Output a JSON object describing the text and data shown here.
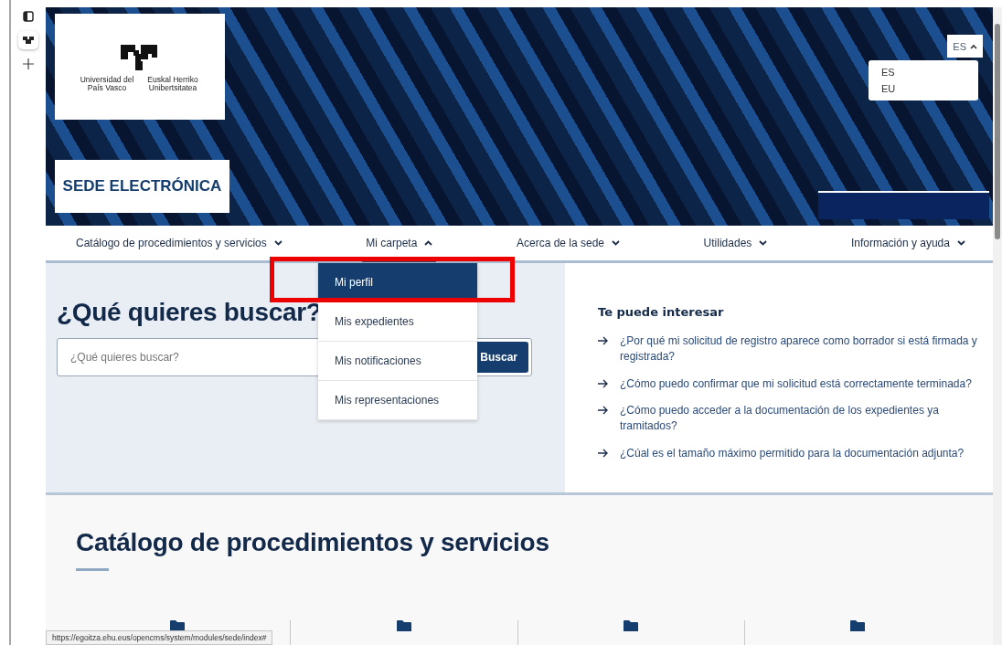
{
  "logo": {
    "name_es": "Universidad del País Vasco",
    "name_eu": "Euskal Herriko Unibertsitatea"
  },
  "site_title": "SEDE ELECTRÓNICA",
  "language": {
    "current": "ES",
    "expanded": true,
    "options": [
      "ES",
      "EU"
    ]
  },
  "nav": [
    {
      "label": "Catálogo de procedimientos y servicios",
      "selected": false,
      "expanded": false
    },
    {
      "label": "Mi carpeta",
      "selected": true,
      "expanded": true
    },
    {
      "label": "Acerca de la sede",
      "selected": false,
      "expanded": false
    },
    {
      "label": "Utilidades",
      "selected": false,
      "expanded": false
    },
    {
      "label": "Información y ayuda",
      "selected": false,
      "expanded": false
    }
  ],
  "submenu": [
    {
      "label": "Mi perfil",
      "selected": true
    },
    {
      "label": "Mis expedientes",
      "selected": false
    },
    {
      "label": "Mis notificaciones",
      "selected": false
    },
    {
      "label": "Mis representaciones",
      "selected": false
    }
  ],
  "search": {
    "heading": "¿Qué quieres buscar?",
    "placeholder": "¿Qué quieres buscar?",
    "button": "Buscar"
  },
  "suggestions": {
    "heading": "Te puede interesar",
    "items": [
      "¿Por qué mi solicitud de registro aparece como borrador si está firmada y registrada?",
      "¿Cómo puedo confirmar que mi solicitud está correctamente terminada?",
      "¿Cómo puedo acceder a la documentación de los expedientes ya tramitados?",
      "¿Cúal es el tamaño máximo permitido para la documentación adjunta?"
    ]
  },
  "catalog": {
    "heading": "Catálogo de procedimientos y servicios"
  },
  "status_url": "https://egoitza.ehu.eus/opencms/system/modules/sede/index#"
}
